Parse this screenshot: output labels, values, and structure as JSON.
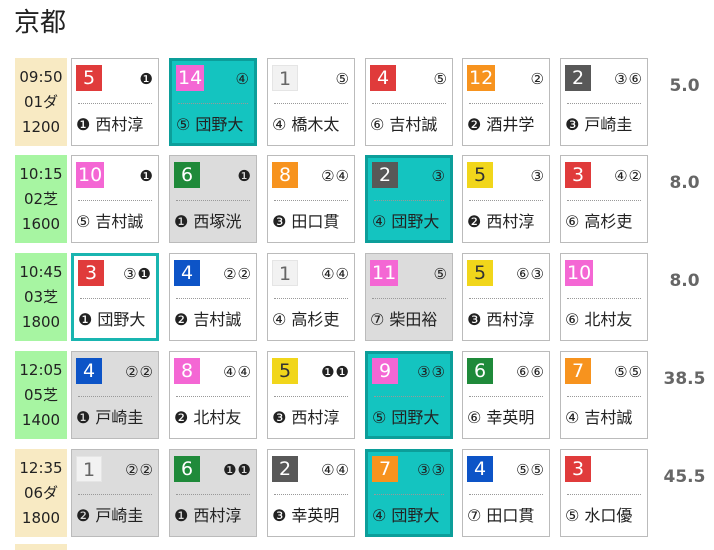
{
  "venue": "京都",
  "races": [
    {
      "time": "09:50",
      "code": "01ダ",
      "dist": "1200",
      "odds": "5.0",
      "info_bg": "dirt",
      "horses": [
        {
          "num": "5",
          "color": "red",
          "marks": "❶",
          "jockey": "❶ 西村淳",
          "style": "white"
        },
        {
          "num": "14",
          "color": "pink",
          "marks": "④",
          "jockey": "⑤ 団野大",
          "style": "teal"
        },
        {
          "num": "1",
          "color": "white",
          "marks": "⑤",
          "jockey": "④ 橋木太",
          "style": "white"
        },
        {
          "num": "4",
          "color": "red",
          "marks": "⑤",
          "jockey": "⑥ 吉村誠",
          "style": "white"
        },
        {
          "num": "12",
          "color": "orange",
          "marks": "②",
          "jockey": "❷ 酒井学",
          "style": "white"
        },
        {
          "num": "2",
          "color": "gray",
          "marks": "③⑥",
          "jockey": "❸ 戸崎圭",
          "style": "white"
        }
      ]
    },
    {
      "time": "10:15",
      "code": "02芝",
      "dist": "1600",
      "odds": "8.0",
      "info_bg": "turf",
      "horses": [
        {
          "num": "10",
          "color": "pink",
          "marks": "❶",
          "jockey": "⑤ 吉村誠",
          "style": "white"
        },
        {
          "num": "6",
          "color": "green",
          "marks": "❶",
          "jockey": "❶ 西塚洸",
          "style": "grey"
        },
        {
          "num": "8",
          "color": "orange",
          "marks": "②④",
          "jockey": "❸ 田口貫",
          "style": "white"
        },
        {
          "num": "2",
          "color": "gray",
          "marks": "③",
          "jockey": "④ 団野大",
          "style": "teal"
        },
        {
          "num": "5",
          "color": "yellow",
          "marks": "③",
          "jockey": "❷ 西村淳",
          "style": "white"
        },
        {
          "num": "3",
          "color": "red",
          "marks": "④②",
          "jockey": "⑥ 高杉吏",
          "style": "white"
        }
      ]
    },
    {
      "time": "10:45",
      "code": "03芝",
      "dist": "1800",
      "odds": "8.0",
      "info_bg": "turf",
      "horses": [
        {
          "num": "3",
          "color": "red",
          "marks": "③❶",
          "jockey": "❶ 団野大",
          "style": "hl"
        },
        {
          "num": "4",
          "color": "blue",
          "marks": "②②",
          "jockey": "❷ 吉村誠",
          "style": "white"
        },
        {
          "num": "1",
          "color": "white",
          "marks": "④④",
          "jockey": "④ 高杉吏",
          "style": "white"
        },
        {
          "num": "11",
          "color": "pink",
          "marks": "⑤",
          "jockey": "⑦ 柴田裕",
          "style": "grey"
        },
        {
          "num": "5",
          "color": "yellow",
          "marks": "⑥③",
          "jockey": "❸ 西村淳",
          "style": "white"
        },
        {
          "num": "10",
          "color": "pink",
          "marks": "",
          "jockey": "⑥ 北村友",
          "style": "white"
        }
      ]
    },
    {
      "time": "12:05",
      "code": "05芝",
      "dist": "1400",
      "odds": "38.5",
      "info_bg": "turf",
      "horses": [
        {
          "num": "4",
          "color": "blue",
          "marks": "②②",
          "jockey": "❶ 戸崎圭",
          "style": "grey"
        },
        {
          "num": "8",
          "color": "pink",
          "marks": "④④",
          "jockey": "❷ 北村友",
          "style": "white"
        },
        {
          "num": "5",
          "color": "yellow",
          "marks": "❶❶",
          "jockey": "❸ 西村淳",
          "style": "white"
        },
        {
          "num": "9",
          "color": "pink",
          "marks": "③③",
          "jockey": "⑤ 団野大",
          "style": "teal"
        },
        {
          "num": "6",
          "color": "green",
          "marks": "⑥⑥",
          "jockey": "⑥ 幸英明",
          "style": "white"
        },
        {
          "num": "7",
          "color": "orange",
          "marks": "⑤⑤",
          "jockey": "④ 吉村誠",
          "style": "white"
        }
      ]
    },
    {
      "time": "12:35",
      "code": "06ダ",
      "dist": "1800",
      "odds": "45.5",
      "info_bg": "dirt",
      "horses": [
        {
          "num": "1",
          "color": "white",
          "marks": "②②",
          "jockey": "❷ 戸崎圭",
          "style": "grey"
        },
        {
          "num": "6",
          "color": "green",
          "marks": "❶❶",
          "jockey": "❶ 西村淳",
          "style": "grey"
        },
        {
          "num": "2",
          "color": "gray",
          "marks": "④④",
          "jockey": "❸ 幸英明",
          "style": "white"
        },
        {
          "num": "7",
          "color": "orange",
          "marks": "③③",
          "jockey": "④ 団野大",
          "style": "teal"
        },
        {
          "num": "4",
          "color": "blue",
          "marks": "⑤⑤",
          "jockey": "⑦ 田口貫",
          "style": "white"
        },
        {
          "num": "3",
          "color": "red",
          "marks": "",
          "jockey": "⑤ 水口優",
          "style": "white"
        }
      ]
    }
  ]
}
